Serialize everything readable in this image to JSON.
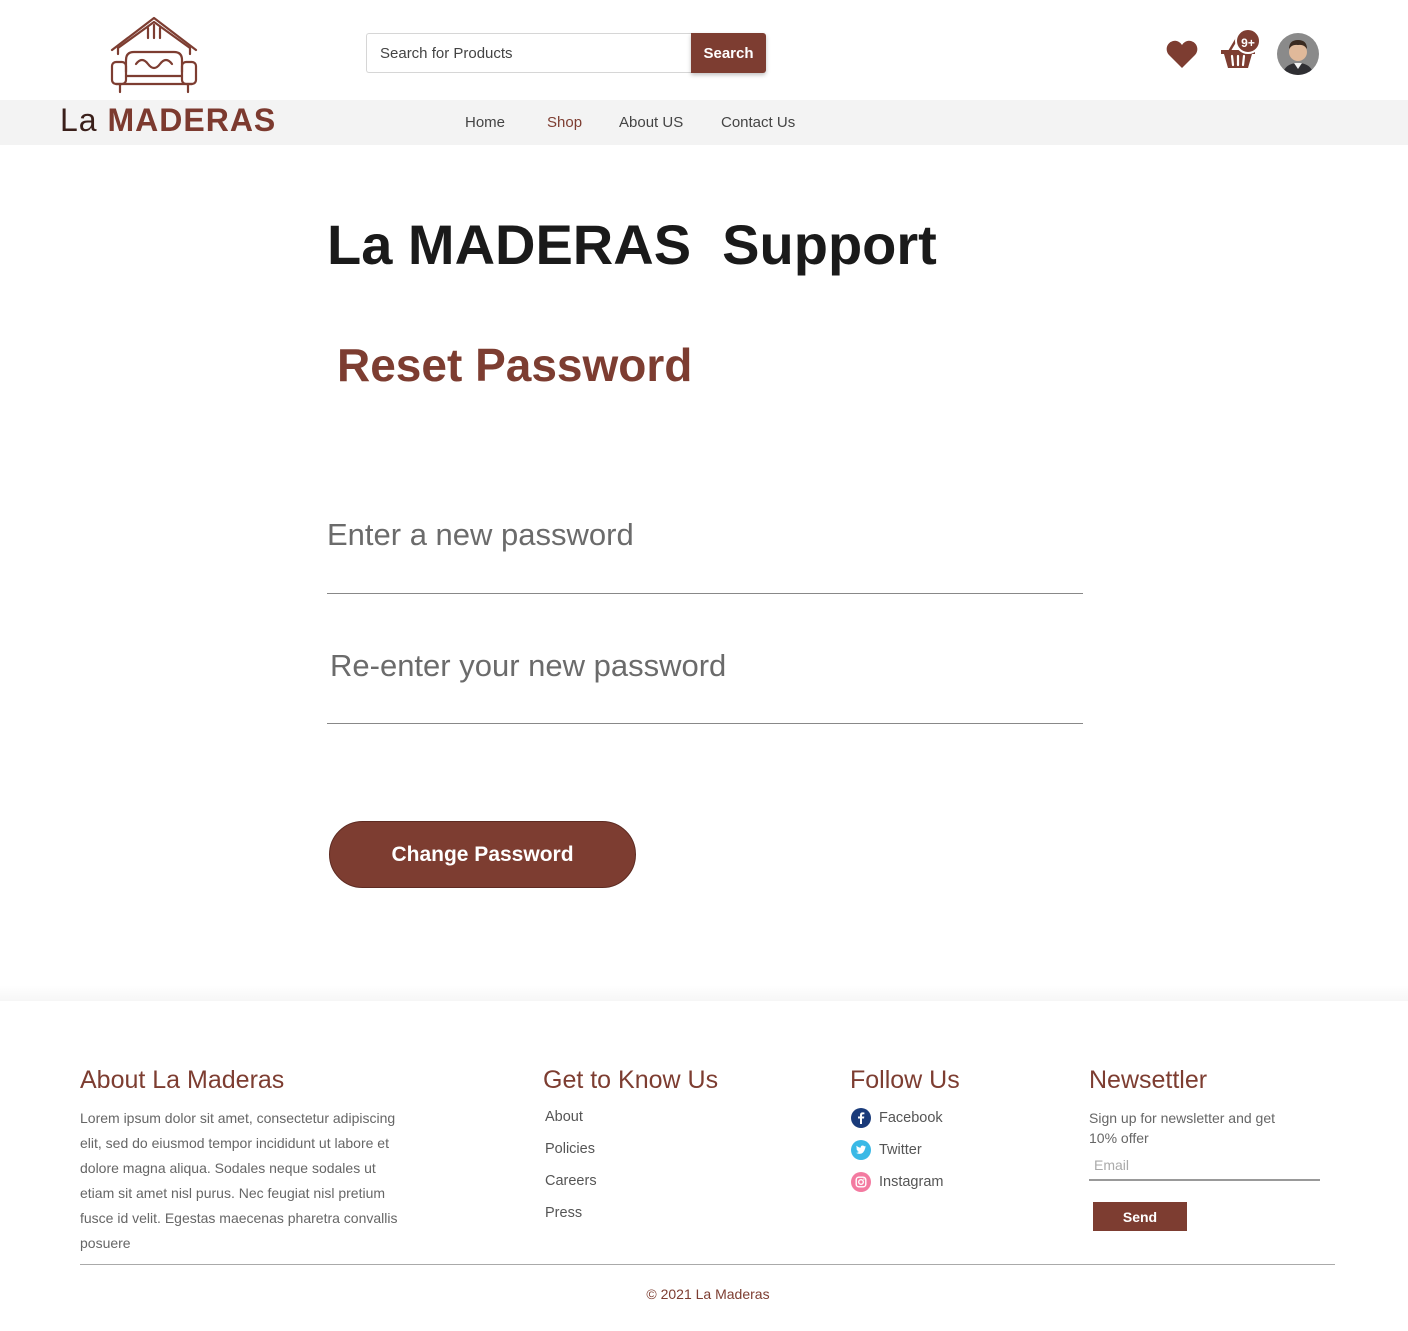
{
  "colors": {
    "accent": "#7d3d31",
    "nav_bg": "#f3f3f3",
    "text": "#444444"
  },
  "header": {
    "logo": {
      "prefix": "La",
      "name": "MADERAS",
      "mark_letters": "la"
    },
    "search": {
      "placeholder": "Search for Products",
      "button_label": "Search"
    },
    "icons": {
      "wishlist": "heart-icon",
      "cart": "basket-icon",
      "cart_badge": "9+",
      "profile": "avatar"
    },
    "nav": [
      {
        "label": "Home",
        "active": false
      },
      {
        "label": "Shop",
        "active": true
      },
      {
        "label": "About US",
        "active": false
      },
      {
        "label": "Contact Us",
        "active": false
      }
    ]
  },
  "main": {
    "support_title": {
      "prefix": "La",
      "brand": "MADERAS",
      "suffix": "Support"
    },
    "reset_title": "Reset Password",
    "new_password_placeholder": "Enter a new password",
    "confirm_password_placeholder": "Re-enter your new password",
    "submit_label": "Change Password"
  },
  "footer": {
    "about": {
      "title": "About La Maderas",
      "text": "Lorem ipsum dolor sit amet, consectetur adipiscing elit, sed do eiusmod tempor incididunt ut labore et dolore magna aliqua. Sodales neque sodales ut etiam sit amet nisl purus. Nec feugiat nisl pretium fusce id velit. Egestas maecenas pharetra convallis posuere"
    },
    "know_us": {
      "title": "Get to Know Us",
      "links": [
        "About",
        "Policies",
        "Careers",
        "Press"
      ]
    },
    "follow": {
      "title": "Follow Us",
      "items": [
        {
          "label": "Facebook",
          "icon": "facebook-icon"
        },
        {
          "label": "Twitter",
          "icon": "twitter-icon"
        },
        {
          "label": "Instagram",
          "icon": "instagram-icon"
        }
      ]
    },
    "newsletter": {
      "title": "Newsettler",
      "description": "Sign up for newsletter and get 10% offer",
      "email_placeholder": "Email",
      "button_label": "Send"
    },
    "copyright": "© 2021 La Maderas"
  }
}
